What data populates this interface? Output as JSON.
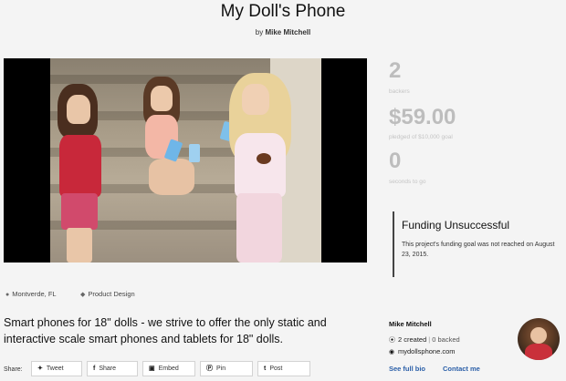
{
  "project": {
    "title": "My Doll's Phone",
    "byline_prefix": "by",
    "creator": "Mike Mitchell"
  },
  "stats": {
    "backers_count": "2",
    "backers_label": "backers",
    "pledged_amount": "$59.00",
    "pledged_label": "pledged of $10,000 goal",
    "time_value": "0",
    "time_label": "seconds to go"
  },
  "funding_status": {
    "title": "Funding Unsuccessful",
    "message": "This project's funding goal was not reached on August 23, 2015."
  },
  "meta": {
    "location": "Montverde, FL",
    "category": "Product Design"
  },
  "blurb": "Smart phones for 18\" dolls - we strive to offer the only static and interactive scale smart phones and tablets for 18\" dolls.",
  "creator_panel": {
    "name": "Mike Mitchell",
    "created": "2 created",
    "backed": "0 backed",
    "website": "mydollsphone.com",
    "full_bio_link": "See full bio",
    "contact_link": "Contact me"
  },
  "share": {
    "label": "Share:",
    "buttons": [
      "Tweet",
      "Share",
      "Embed",
      "Pin",
      "Post"
    ]
  },
  "icons": {
    "location": "map-pin-icon",
    "category": "tag-icon",
    "created": "circle-check-icon",
    "website": "globe-icon"
  }
}
